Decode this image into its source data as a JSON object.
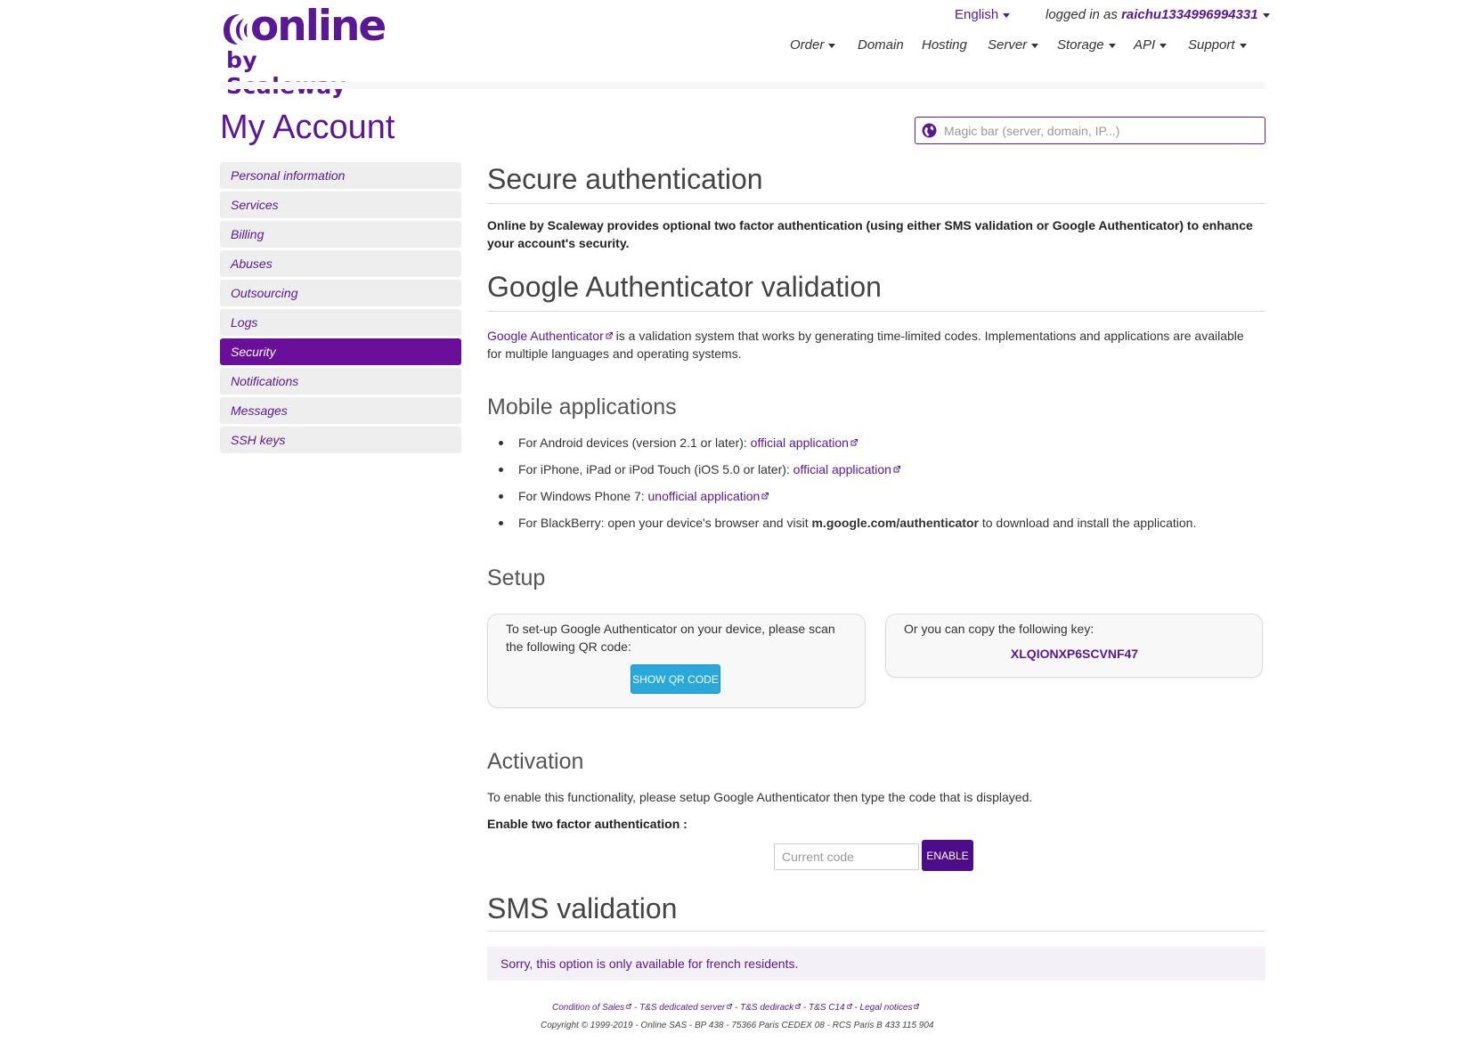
{
  "brand": {
    "logo_word": "online",
    "logo_sub": "by Scaleway",
    "accent_color": "#5a1796",
    "active_color": "#6a0f9a"
  },
  "top": {
    "language": "English",
    "logged_prefix": "logged in as",
    "username": "raichu1334996994331"
  },
  "nav": [
    {
      "label": "Order",
      "dropdown": true
    },
    {
      "label": "Domain",
      "dropdown": false
    },
    {
      "label": "Hosting",
      "dropdown": false
    },
    {
      "label": "Server",
      "dropdown": true
    },
    {
      "label": "Storage",
      "dropdown": true
    },
    {
      "label": "API",
      "dropdown": true
    },
    {
      "label": "Support",
      "dropdown": true
    }
  ],
  "page_title": "My Account",
  "magic_bar": {
    "placeholder": "Magic bar (server, domain, IP...)",
    "icon": "globe-icon"
  },
  "sidebar": {
    "items": [
      {
        "label": "Personal information",
        "active": false
      },
      {
        "label": "Services",
        "active": false
      },
      {
        "label": "Billing",
        "active": false
      },
      {
        "label": "Abuses",
        "active": false
      },
      {
        "label": "Outsourcing",
        "active": false
      },
      {
        "label": "Logs",
        "active": false
      },
      {
        "label": "Security",
        "active": true
      },
      {
        "label": "Notifications",
        "active": false
      },
      {
        "label": "Messages",
        "active": false
      },
      {
        "label": "SSH keys",
        "active": false
      }
    ]
  },
  "secure": {
    "title": "Secure authentication",
    "intro": "Online by Scaleway provides optional two factor authentication (using either SMS validation or Google Authenticator) to enhance your account's security."
  },
  "google": {
    "title": "Google Authenticator validation",
    "link": "Google Authenticator",
    "desc_line1": " is a validation system that works by generating time-limited codes. Implementations and applications are available",
    "desc_line2": "for multiple languages and operating systems."
  },
  "mobile": {
    "title": "Mobile applications",
    "items": [
      {
        "text": "For Android devices (version 2.1 or later): ",
        "link": "official application"
      },
      {
        "text": "For iPhone, iPad or iPod Touch (iOS 5.0 or later): ",
        "link": "official application"
      },
      {
        "text": "For Windows Phone 7: ",
        "link": "unofficial application"
      }
    ],
    "blackberry_pre": "For BlackBerry: open your device's browser and visit ",
    "blackberry_bold": "m.google.com/authenticator",
    "blackberry_post": " to download and install the application."
  },
  "setup": {
    "title": "Setup",
    "qr_text_line1": "To set-up Google Authenticator on your device, please scan",
    "qr_text_line2": "the following QR code:",
    "qr_button": "SHOW QR CODE",
    "key_text": "Or you can copy the following key:",
    "key": "XLQIONXP6SCVNF47"
  },
  "activation": {
    "title": "Activation",
    "desc": "To enable this functionality, please setup Google Authenticator then type the code that is displayed.",
    "label": "Enable two factor authentication :",
    "input_placeholder": "Current code",
    "button": "ENABLE"
  },
  "sms": {
    "title": "SMS validation",
    "notice": "Sorry, this option is only available for french residents."
  },
  "footer": {
    "links": [
      "Condition of Sales",
      "T&S dedicated server",
      "T&S dedirack",
      "T&S C14",
      "Legal notices"
    ],
    "separator": " - ",
    "copyright": "Copyright © 1999-2019 - Online SAS - BP 438 - 75366 Paris CEDEX 08 - RCS Paris B 433 115 904"
  }
}
